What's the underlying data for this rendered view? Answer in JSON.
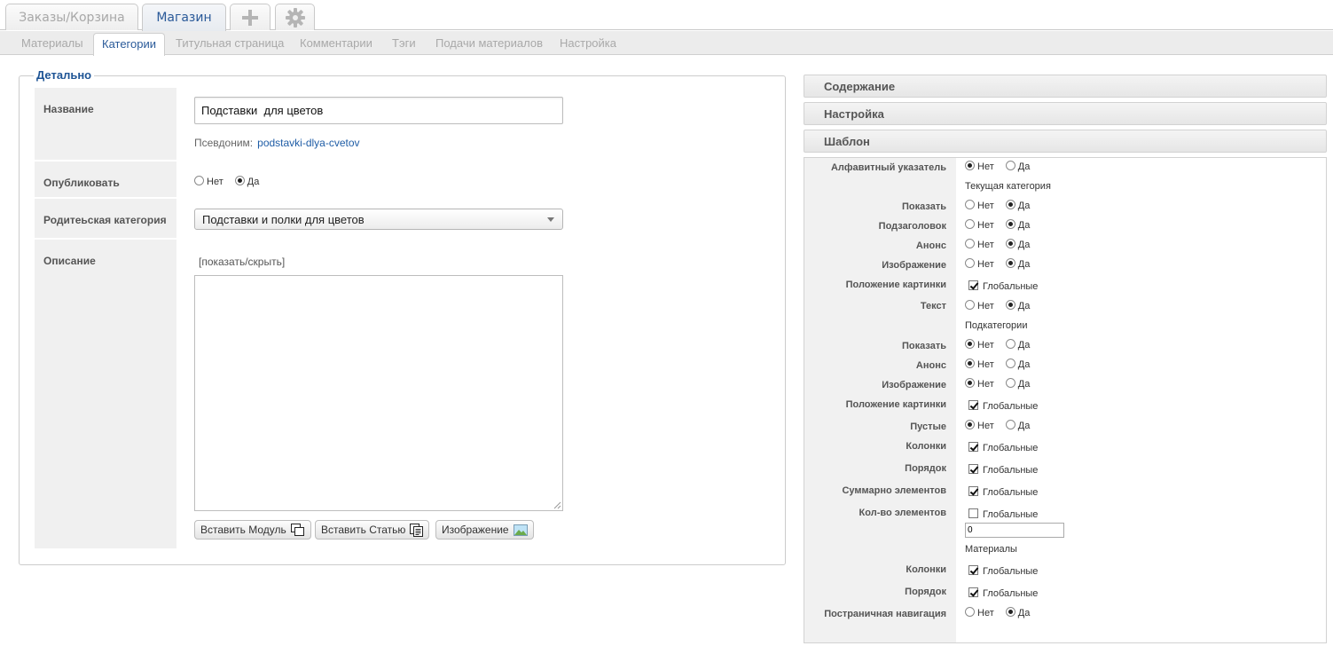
{
  "top_tabs": {
    "orders": "Заказы/Корзина",
    "shop": "Магазин",
    "add_icon": "plus-icon",
    "settings_icon": "gear-icon"
  },
  "sub_tabs": [
    "Материалы",
    "Категории",
    "Титульная страница",
    "Комментарии",
    "Тэги",
    "Подачи материалов",
    "Настройка"
  ],
  "details": {
    "legend": "Детально",
    "name_label": "Название",
    "name_value": "Подставки  для цветов",
    "alias_label": "Псевдоним:",
    "alias_value": "podstavki-dlya-cvetov",
    "publish_label": "Опубликовать",
    "publish_no": "Нет",
    "publish_yes": "Да",
    "publish_selected": "Да",
    "parent_label": "Родитеьская категория",
    "parent_value": "Подставки и полки для цветов",
    "description_label": "Описание",
    "toggle_link": "[показать/скрыть]",
    "buttons": {
      "insert_module": "Вставить Модуль",
      "insert_article": "Вставить Статью",
      "image": "Изображение"
    }
  },
  "right_panel": {
    "sections": {
      "content": "Содержание",
      "settings": "Настройка",
      "template": "Шаблон"
    },
    "opt_no": "Нет",
    "opt_yes": "Да",
    "global": "Глобальные",
    "alphabet": {
      "label": "Алфавитный указатель",
      "selected": "Нет"
    },
    "current_category": {
      "title": "Текущая категория",
      "show": {
        "label": "Показать",
        "selected": "Да"
      },
      "subtitle": {
        "label": "Подзаголовок",
        "selected": "Да"
      },
      "announce": {
        "label": "Анонс",
        "selected": "Да"
      },
      "image": {
        "label": "Изображение",
        "selected": "Да"
      },
      "image_position": {
        "label": "Положение картинки",
        "checked": true
      },
      "text": {
        "label": "Текст",
        "selected": "Да"
      }
    },
    "subcategories": {
      "title": "Подкатегории",
      "show": {
        "label": "Показать",
        "selected": "Нет"
      },
      "announce": {
        "label": "Анонс",
        "selected": "Нет"
      },
      "image": {
        "label": "Изображение",
        "selected": "Нет"
      },
      "image_position": {
        "label": "Положение картинки",
        "checked": true
      },
      "empty": {
        "label": "Пустые",
        "selected": "Нет"
      },
      "columns": {
        "label": "Колонки",
        "checked": true
      },
      "order": {
        "label": "Порядок",
        "checked": true
      },
      "total_items": {
        "label": "Суммарно элементов",
        "checked": true
      },
      "items_count": {
        "label": "Кол-во элементов",
        "checked": false,
        "value": "0"
      }
    },
    "materials": {
      "title": "Материалы",
      "columns": {
        "label": "Колонки",
        "checked": true
      },
      "order": {
        "label": "Порядок",
        "checked": true
      },
      "pagination": {
        "label": "Постраничная навигация",
        "selected": "Да"
      }
    }
  }
}
